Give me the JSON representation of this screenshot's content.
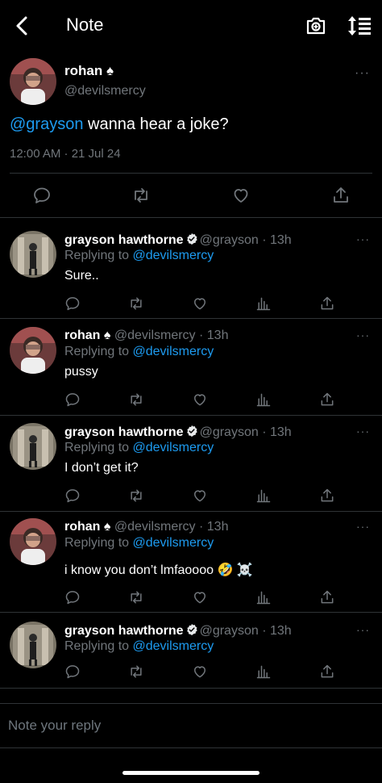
{
  "header": {
    "title": "Note",
    "icons": [
      "back-chevron-icon",
      "camera-icon",
      "sort-icon"
    ]
  },
  "main_post": {
    "name": "rohan ♠",
    "handle": "@devilsmercy",
    "mention": "@grayson",
    "text": " wanna hear a joke?",
    "timestamp": "12:00 AM · 21 Jul 24",
    "more": "···"
  },
  "replies": [
    {
      "name": "grayson hawthorne",
      "verified": true,
      "meta": "@grayson · 13h",
      "replying_label": "Replying to",
      "replying_to": "@devilsmercy",
      "text": "Sure..",
      "more": "···"
    },
    {
      "name": "rohan ♠",
      "verified": false,
      "meta": "@devilsmercy · 13h",
      "replying_label": "Replying to",
      "replying_to": "@devilsmercy",
      "text": "pussy",
      "more": "···"
    },
    {
      "name": "grayson hawthorne",
      "verified": true,
      "meta": "@grayson · 13h",
      "replying_label": "Replying to",
      "replying_to": "@devilsmercy",
      "text": "I don’t get it?",
      "more": "···"
    },
    {
      "name": "rohan ♠",
      "verified": false,
      "meta": "@devilsmercy · 13h",
      "replying_label": "Replying to",
      "replying_to": "@devilsmercy",
      "text": "i know you don’t lmfaoooo 🤣 ☠️",
      "more": "···"
    },
    {
      "name": "grayson hawthorne",
      "verified": true,
      "meta": "@grayson · 13h",
      "replying_label": "Replying to",
      "replying_to": "@devilsmercy",
      "text": "",
      "more": "···"
    }
  ],
  "reply_input": {
    "placeholder": "Note your reply"
  },
  "colors": {
    "background": "#000000",
    "accent": "#1d9bf0",
    "muted": "#71767b"
  }
}
